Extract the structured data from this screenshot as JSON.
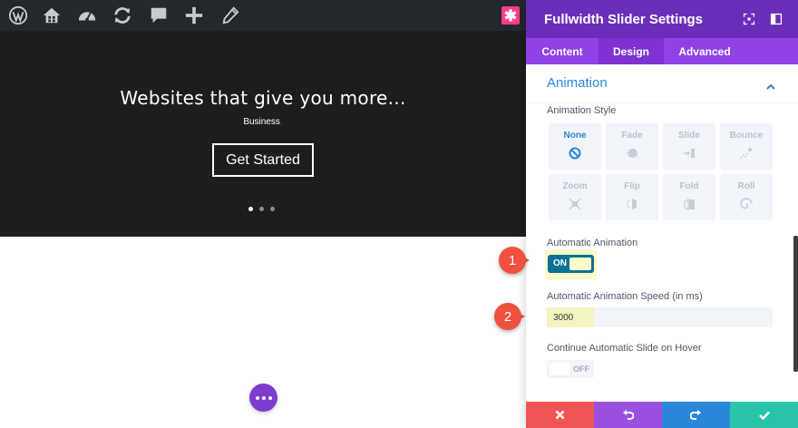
{
  "toolbar": {
    "icons": [
      "wordpress-icon",
      "home-icon",
      "dashboard-icon",
      "refresh-icon",
      "comment-icon",
      "plus-icon",
      "edit-icon"
    ]
  },
  "hero": {
    "title": "Websites that give you more...",
    "subtitle": "Business",
    "subtitle_punct": ".",
    "button_label": "Get Started",
    "slide_count": 3,
    "active_slide": 1
  },
  "panel": {
    "title": "Fullwidth Slider Settings",
    "tabs": [
      {
        "label": "Content",
        "active": false
      },
      {
        "label": "Design",
        "active": true
      },
      {
        "label": "Advanced",
        "active": false
      }
    ],
    "section_title": "Animation",
    "animation_style_label": "Animation Style",
    "animation_styles": [
      {
        "label": "None",
        "selected": true
      },
      {
        "label": "Fade",
        "selected": false
      },
      {
        "label": "Slide",
        "selected": false
      },
      {
        "label": "Bounce",
        "selected": false
      },
      {
        "label": "Zoom",
        "selected": false
      },
      {
        "label": "Flip",
        "selected": false
      },
      {
        "label": "Fold",
        "selected": false
      },
      {
        "label": "Roll",
        "selected": false
      }
    ],
    "auto_animation_label": "Automatic Animation",
    "auto_animation_state": "ON",
    "speed_label": "Automatic Animation Speed (in ms)",
    "speed_value": "3000",
    "hover_label": "Continue Automatic Slide on Hover",
    "hover_state": "OFF"
  },
  "annotations": {
    "badge_1": "1",
    "badge_2": "2"
  },
  "colors": {
    "panel_header": "#6c2eb9",
    "tabs_bg": "#8e42e6",
    "accent_blue": "#2b87da",
    "toggle_on": "#0c7196",
    "highlight": "#fdfbc6",
    "cancel": "#ef5555",
    "undo": "#9b51e0",
    "redo": "#2b87da",
    "save": "#29c4a9",
    "badge": "#f0503f"
  }
}
